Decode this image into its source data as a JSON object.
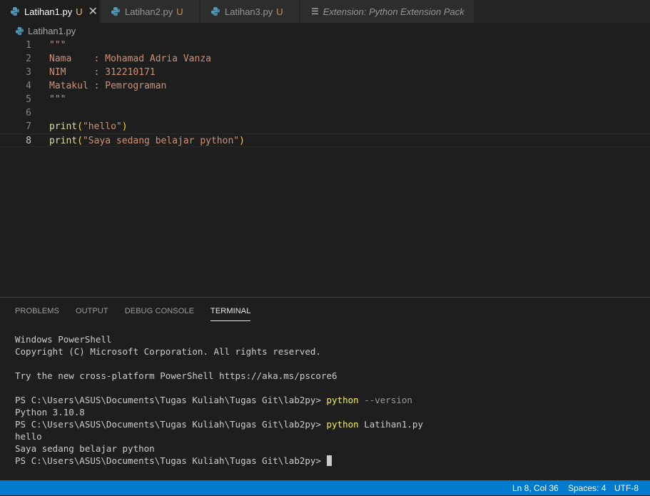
{
  "tabs": [
    {
      "label": "Latihan1.py",
      "modified": "U",
      "active": true
    },
    {
      "label": "Latihan2.py",
      "modified": "U",
      "active": false
    },
    {
      "label": "Latihan3.py",
      "modified": "U",
      "active": false
    },
    {
      "label": "Extension: Python Extension Pack",
      "modified": "",
      "active": false
    }
  ],
  "breadcrumb": {
    "file": "Latihan1.py"
  },
  "editor": {
    "line_numbers": [
      "1",
      "2",
      "3",
      "4",
      "5",
      "6",
      "7",
      "8"
    ],
    "lines": {
      "l1": "\"\"\"",
      "l2": "Nama    : Mohamad Adria Vanza",
      "l3": "NIM     : 312210171",
      "l4": "Matakul : Pemrograman",
      "l5": "\"\"\"",
      "l7_fn": "print",
      "l7_str": "\"hello\"",
      "l8_fn": "print",
      "l8_str": "\"Saya sedang belajar python\""
    }
  },
  "panel": {
    "tabs": [
      "PROBLEMS",
      "OUTPUT",
      "DEBUG CONSOLE",
      "TERMINAL"
    ],
    "terminal": {
      "t1": "Windows PowerShell",
      "t2": "Copyright (C) Microsoft Corporation. All rights reserved.",
      "t3": "Try the new cross-platform PowerShell https://aka.ms/pscore6",
      "prompt": "PS C:\\Users\\ASUS\\Documents\\Tugas Kuliah\\Tugas Git\\lab2py> ",
      "cmd1": "python",
      "cmd1_arg": "--version",
      "out1": "Python 3.10.8",
      "cmd2": "python",
      "cmd2_arg": "Latihan1.py",
      "out2": "hello",
      "out3": "Saya sedang belajar python"
    }
  },
  "statusbar": {
    "position": "Ln 8, Col 36",
    "spaces": "Spaces: 4",
    "encoding": "UTF-8"
  },
  "colors": {
    "accent": "#007acc",
    "python_icon": "#519aba",
    "string": "#ce9178",
    "function": "#dcdcaa",
    "terminal_cmd": "#f5f543"
  }
}
